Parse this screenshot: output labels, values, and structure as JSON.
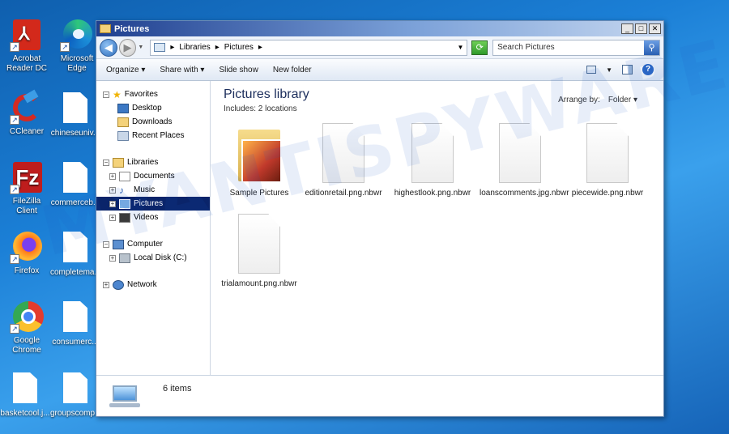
{
  "watermark": "MYANTISPYWARE.COM",
  "desktop": [
    {
      "label": "Acrobat Reader DC",
      "icon": "acrobat-icon"
    },
    {
      "label": "Microsoft Edge",
      "icon": "edge-icon"
    },
    {
      "label": "CCleaner",
      "icon": "ccleaner-icon"
    },
    {
      "label": "chineseuniv...",
      "icon": "file-icon"
    },
    {
      "label": "FileZilla Client",
      "icon": "filezilla-icon"
    },
    {
      "label": "commerceb...",
      "icon": "file-icon"
    },
    {
      "label": "Firefox",
      "icon": "firefox-icon"
    },
    {
      "label": "completema...",
      "icon": "file-icon"
    },
    {
      "label": "Google Chrome",
      "icon": "chrome-icon"
    },
    {
      "label": "consumerc...",
      "icon": "file-icon"
    },
    {
      "label": "basketcool.j...",
      "icon": "file-icon"
    },
    {
      "label": "groupscomp...",
      "icon": "file-icon"
    }
  ],
  "window": {
    "title": "Pictures",
    "controls": {
      "minimize": "_",
      "maximize": "□",
      "close": "✕"
    }
  },
  "address": {
    "crumbs": [
      "Libraries",
      "Pictures"
    ],
    "search_placeholder": "Search Pictures"
  },
  "toolbar": {
    "organize": "Organize",
    "share_with": "Share with",
    "slide_show": "Slide show",
    "new_folder": "New folder"
  },
  "nav": {
    "favorites": "Favorites",
    "desktop": "Desktop",
    "downloads": "Downloads",
    "recent_places": "Recent Places",
    "libraries": "Libraries",
    "documents": "Documents",
    "music": "Music",
    "pictures": "Pictures",
    "videos": "Videos",
    "computer": "Computer",
    "local_disk": "Local Disk (C:)",
    "network": "Network"
  },
  "library": {
    "title": "Pictures library",
    "includes": "Includes:  2 locations",
    "arrange_label": "Arrange by:",
    "arrange_value": "Folder"
  },
  "files": [
    {
      "name": "Sample Pictures",
      "type": "folder"
    },
    {
      "name": "editionretail.png.nbwr",
      "type": "file"
    },
    {
      "name": "highestlook.png.nbwr",
      "type": "file"
    },
    {
      "name": "loanscomments.jpg.nbwr",
      "type": "file"
    },
    {
      "name": "piecewide.png.nbwr",
      "type": "file"
    },
    {
      "name": "trialamount.png.nbwr",
      "type": "file"
    }
  ],
  "status": {
    "items": "6 items"
  }
}
